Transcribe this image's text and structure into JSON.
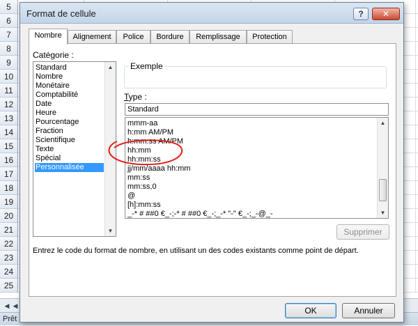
{
  "sheet": {
    "row_numbers": [
      "5",
      "6",
      "7",
      "8",
      "9",
      "10",
      "11",
      "12",
      "13",
      "14",
      "15",
      "16",
      "17",
      "18",
      "19",
      "20",
      "21",
      "22",
      "23",
      "24",
      "25"
    ],
    "status_text": "Prêt"
  },
  "dialog": {
    "title": "Format de cellule",
    "help_button": "?",
    "close_button": "✕",
    "tabs": [
      {
        "label": "Nombre",
        "active": true
      },
      {
        "label": "Alignement"
      },
      {
        "label": "Police"
      },
      {
        "label": "Bordure"
      },
      {
        "label": "Remplissage"
      },
      {
        "label": "Protection"
      }
    ],
    "category": {
      "label": "Catégorie :",
      "items": [
        "Standard",
        "Nombre",
        "Monétaire",
        "Comptabilité",
        "Date",
        "Heure",
        "Pourcentage",
        "Fraction",
        "Scientifique",
        "Texte",
        "Spécial",
        "Personnalisée"
      ],
      "selected": "Personnalisée"
    },
    "sample": {
      "label": "Exemple",
      "value": ""
    },
    "type": {
      "label": "Type :",
      "value": "Standard",
      "list": [
        "mmm-aa",
        "h:mm AM/PM",
        "h:mm:ss AM/PM",
        "hh:mm",
        "hh:mm:ss",
        "jj/mm/aaaa hh:mm",
        "mm:ss",
        "mm:ss,0",
        "@",
        "[h]:mm:ss",
        "_-* # ##0 €_-;-* # ##0 €_-;_-* \"-\" €_-;_-@_-"
      ]
    },
    "delete_button": "Supprimer",
    "description": "Entrez le code du format de nombre, en utilisant un des codes existants comme point de départ.",
    "ok_button": "OK",
    "cancel_button": "Annuler"
  },
  "colors": {
    "selection": "#3399ff",
    "annotation": "#e0201a"
  }
}
